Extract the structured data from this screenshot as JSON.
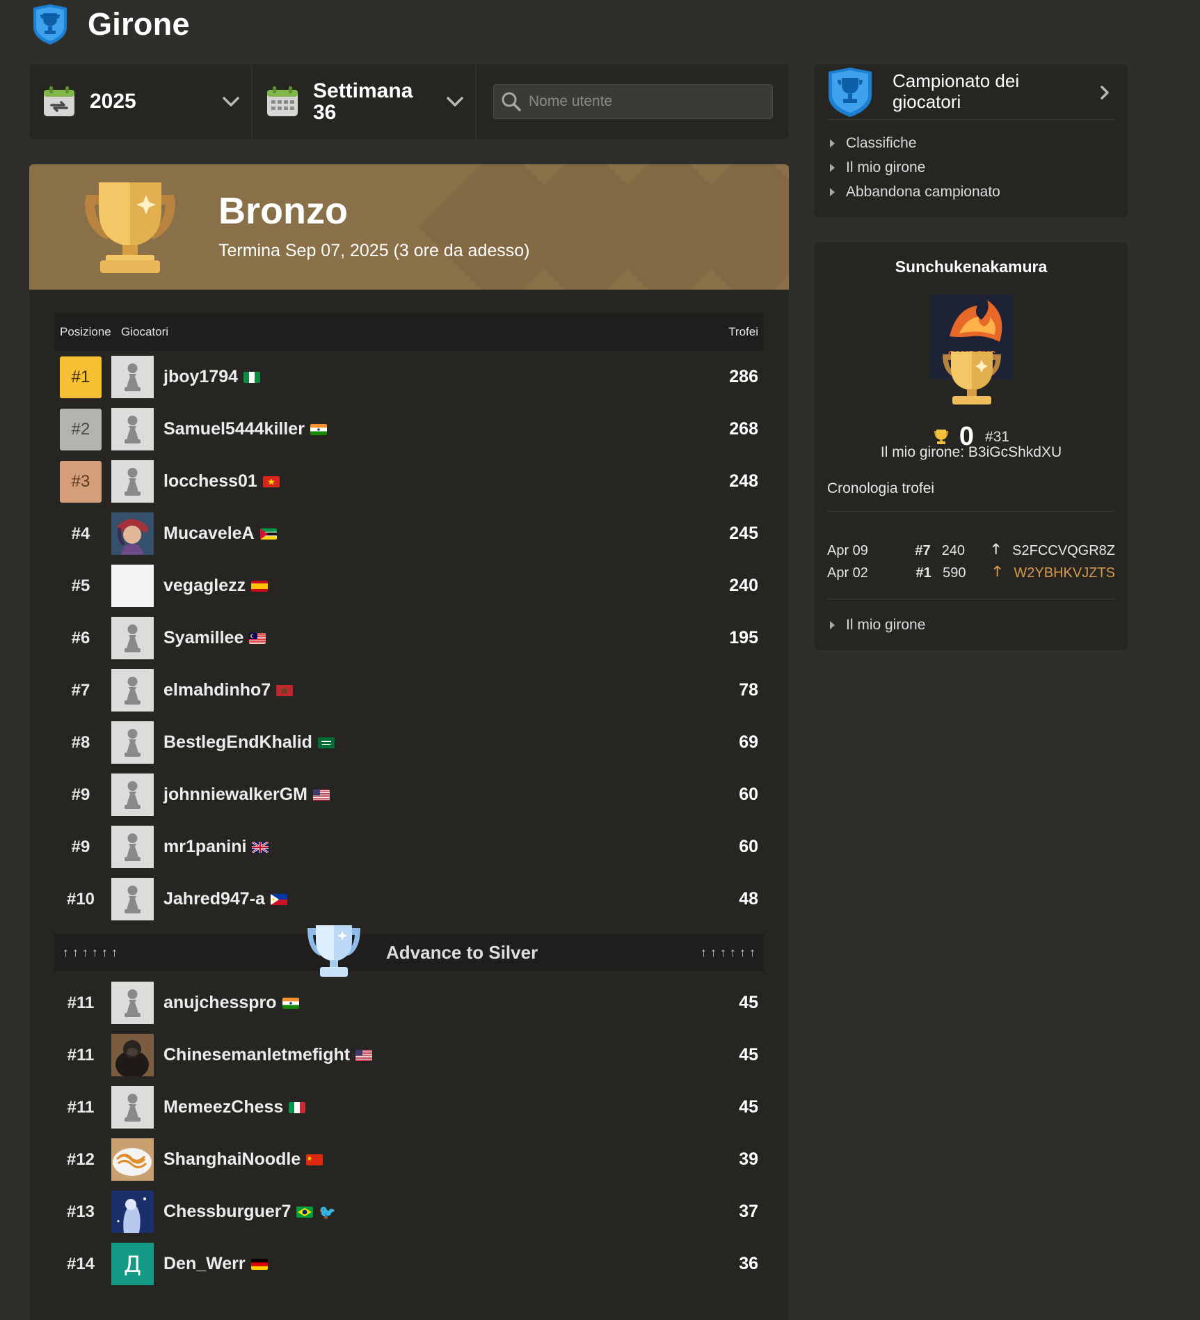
{
  "header": {
    "title": "Girone"
  },
  "filters": {
    "year": "2025",
    "week": "Settimana 36",
    "search_placeholder": "Nome utente"
  },
  "banner": {
    "title": "Bronzo",
    "subtitle": "Termina Sep 07, 2025 (3 ore da adesso)"
  },
  "table": {
    "col_position": "Posizione",
    "col_players": "Giocatori",
    "col_trophies": "Trofei",
    "rows_top": [
      {
        "rank": "#1",
        "name": "jboy1794",
        "score": "286",
        "flag": "nigeria",
        "avatar": "pawn",
        "medal": "gold"
      },
      {
        "rank": "#2",
        "name": "Samuel5444killer",
        "score": "268",
        "flag": "india",
        "avatar": "pawn",
        "medal": "silver"
      },
      {
        "rank": "#3",
        "name": "locchess01",
        "score": "248",
        "flag": "vietnam",
        "avatar": "pawn",
        "medal": "bronze"
      },
      {
        "rank": "#4",
        "name": "MucaveleA",
        "score": "245",
        "flag": "mozambique",
        "avatar": "anime",
        "medal": ""
      },
      {
        "rank": "#5",
        "name": "vegaglezz",
        "score": "240",
        "flag": "spain",
        "avatar": "blank",
        "medal": ""
      },
      {
        "rank": "#6",
        "name": "Syamillee",
        "score": "195",
        "flag": "malaysia",
        "avatar": "pawn",
        "medal": ""
      },
      {
        "rank": "#7",
        "name": "elmahdinho7",
        "score": "78",
        "flag": "morocco",
        "avatar": "pawn",
        "medal": ""
      },
      {
        "rank": "#8",
        "name": "BestlegEndKhalid",
        "score": "69",
        "flag": "saudi-arabia",
        "avatar": "pawn",
        "medal": ""
      },
      {
        "rank": "#9",
        "name": "johnniewalkerGM",
        "score": "60",
        "flag": "usa",
        "avatar": "pawn",
        "medal": ""
      },
      {
        "rank": "#9",
        "name": "mr1panini",
        "score": "60",
        "flag": "uk",
        "avatar": "pawn",
        "medal": ""
      },
      {
        "rank": "#10",
        "name": "Jahred947-a",
        "score": "48",
        "flag": "philippines",
        "avatar": "pawn",
        "medal": ""
      }
    ],
    "advance_label": "Advance to Silver",
    "rows_bottom": [
      {
        "rank": "#11",
        "name": "anujchesspro",
        "score": "45",
        "flag": "india",
        "avatar": "pawn"
      },
      {
        "rank": "#11",
        "name": "Chinesemanletmefight",
        "score": "45",
        "flag": "usa",
        "avatar": "gorilla"
      },
      {
        "rank": "#11",
        "name": "MemeezChess",
        "score": "45",
        "flag": "italy",
        "avatar": "pawn"
      },
      {
        "rank": "#12",
        "name": "ShanghaiNoodle",
        "score": "39",
        "flag": "china",
        "avatar": "noodles"
      },
      {
        "rank": "#13",
        "name": "Chessburguer7",
        "score": "37",
        "flag": "brazil",
        "avatar": "blue-art"
      },
      {
        "rank": "#14",
        "name": "Den_Werr",
        "score": "36",
        "flag": "germany",
        "avatar": "letter",
        "avatar_letter": "Д"
      }
    ]
  },
  "sidebar": {
    "championship": {
      "title": "Campionato dei giocatori",
      "links": [
        "Classifiche",
        "Il mio girone",
        "Abbandona campionato"
      ]
    },
    "profile": {
      "username": "Sunchukenakamura",
      "trophies": "0",
      "rank": "#31",
      "group": "Il mio girone: B3iGcShkdXU",
      "history_title": "Cronologia trofei",
      "history": [
        {
          "date": "Apr 09",
          "rank": "#7",
          "trophies": "240",
          "group": "S2FCCVQGR8Z"
        },
        {
          "date": "Apr 02",
          "rank": "#1",
          "trophies": "590",
          "group": "W2YBHKVJZTS"
        }
      ],
      "link": "Il mio girone"
    }
  },
  "colors": {
    "background": "#302e2b",
    "panel": "#262522",
    "banner": "#8a7048",
    "gold": "#f6c035",
    "silver": "#b4b3b0",
    "bronze": "#d49e78",
    "accent_orange": "#d79a4e"
  }
}
